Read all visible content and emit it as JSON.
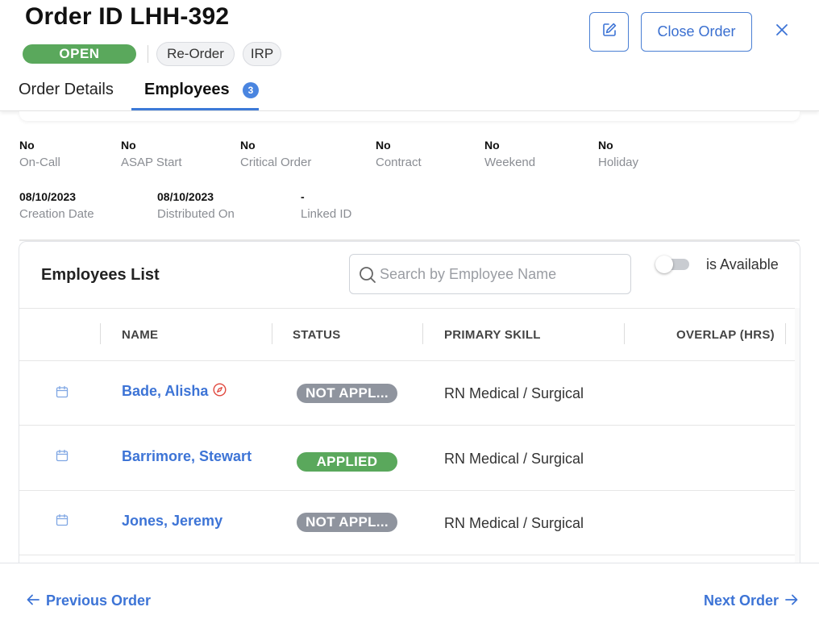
{
  "order": {
    "title": "Order ID LHH-392",
    "status": "OPEN",
    "tags": [
      "Re-Order",
      "IRP"
    ],
    "close_label": "Close Order"
  },
  "tabs": [
    {
      "label": "Order Details"
    },
    {
      "label": "Employees",
      "badge": "3"
    }
  ],
  "details": {
    "row1": [
      {
        "value": "No",
        "label": "On-Call"
      },
      {
        "value": "No",
        "label": "ASAP Start"
      },
      {
        "value": "No",
        "label": "Critical Order"
      },
      {
        "value": "No",
        "label": "Contract"
      },
      {
        "value": "No",
        "label": "Weekend"
      },
      {
        "value": "No",
        "label": "Holiday"
      }
    ],
    "row2": [
      {
        "value": "08/10/2023",
        "label": "Creation Date"
      },
      {
        "value": "08/10/2023",
        "label": "Distributed On"
      },
      {
        "value": "-",
        "label": "Linked ID"
      }
    ]
  },
  "employees_list": {
    "title": "Employees List",
    "search_placeholder": "Search by Employee Name",
    "toggle_label": "is Available",
    "columns": [
      "NAME",
      "STATUS",
      "PRIMARY SKILL",
      "OVERLAP (HRS)"
    ],
    "rows": [
      {
        "name": "Bade, Alisha",
        "status": "NOT APPL...",
        "status_color": "#8f949e",
        "skill": "RN Medical / Surgical"
      },
      {
        "name": "Barrimore, Stewart",
        "status": "APPLIED",
        "status_color": "#5aa85c",
        "skill": "RN Medical / Surgical"
      },
      {
        "name": "Jones, Jeremy",
        "status": "NOT APPL...",
        "status_color": "#8f949e",
        "skill": "RN Medical / Surgical"
      }
    ]
  },
  "footer": {
    "prev_label": "Previous Order",
    "next_label": "Next Order"
  },
  "colors": {
    "accent": "#3d74d6",
    "open_green": "#5aa85c",
    "not_applied_grey": "#8f949e"
  }
}
